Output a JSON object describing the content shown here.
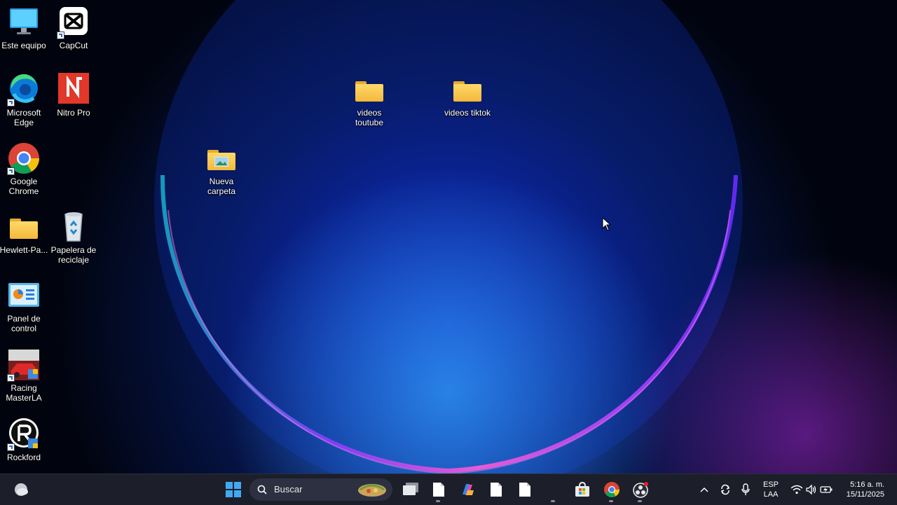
{
  "desktop": {
    "icons": {
      "este_equipo": "Este equipo",
      "capcut": "CapCut",
      "edge": "Microsoft Edge",
      "nitro": "Nitro Pro",
      "chrome": "Google Chrome",
      "hewlett": "Hewlett-Pa...",
      "papelera": "Papelera de reciclaje",
      "panel": "Panel de control",
      "racing": "Racing MasterLA",
      "rockford": "Rockford",
      "videos_youtube": "videos toutube",
      "videos_tiktok": "videos tiktok",
      "nueva_carpeta": "Nueva carpeta"
    }
  },
  "taskbar": {
    "search_label": "Buscar",
    "language_line1": "ESP",
    "language_line2": "LAA",
    "time": "5:16 a. m.",
    "date": "15/11/2025",
    "icons": [
      "weather-icon",
      "windows-start-icon",
      "search-icon",
      "task-view-icon",
      "file-icon",
      "copilot-icon",
      "file-icon",
      "file-icon",
      "store-icon",
      "chrome-icon",
      "obs-icon",
      "chevron-up-icon",
      "sync-icon",
      "microphone-icon",
      "wifi-icon",
      "volume-icon",
      "battery-icon"
    ]
  },
  "colors": {
    "taskbar_bg": "#1c1f2a",
    "folder_yellow": "#f4b83a",
    "accent_blue": "#2b6cd8"
  }
}
